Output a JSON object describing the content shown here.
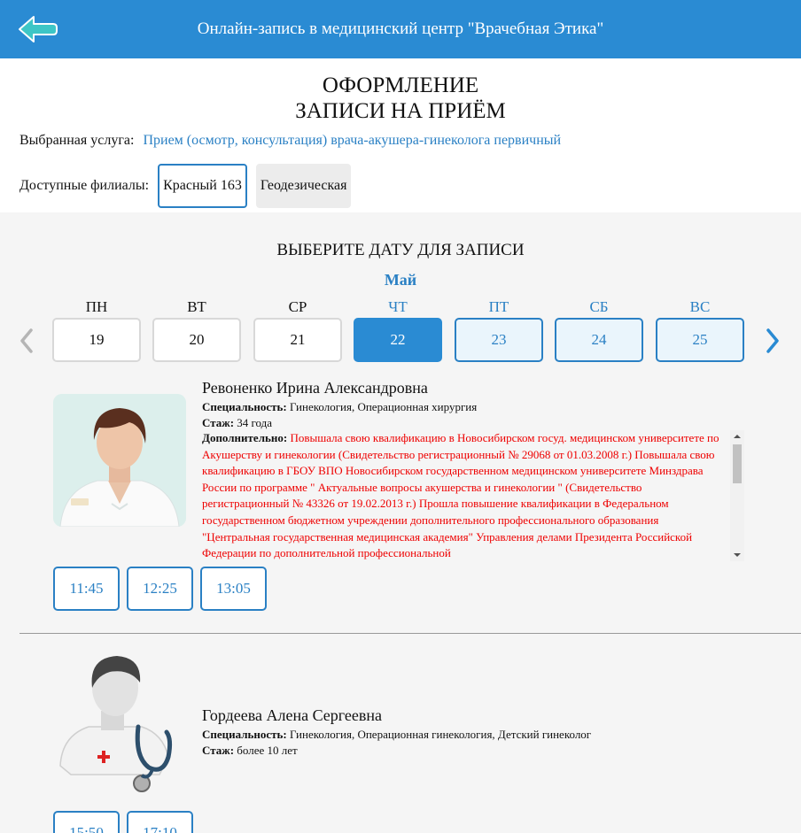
{
  "header": {
    "title": "Онлайн-запись в медицинский центр \"Врачебная Этика\"",
    "back_icon": "back-arrow-icon"
  },
  "page": {
    "title_line1": "ОФОРМЛЕНИЕ",
    "title_line2": "ЗАПИСИ НА ПРИЁМ"
  },
  "service": {
    "label": "Выбранная услуга:",
    "value": "Прием (осмотр, консультация) врача-акушера-гинеколога первичный"
  },
  "branches": {
    "label": "Доступные филиалы:",
    "items": [
      "Красный 163",
      "Геодезическая"
    ],
    "selected": "Красный 163"
  },
  "calendar": {
    "title": "ВЫБЕРИТЕ ДАТУ ДЛЯ ЗАПИСИ",
    "month": "Май",
    "days": [
      {
        "name": "ПН",
        "date": "19",
        "state": "past"
      },
      {
        "name": "ВТ",
        "date": "20",
        "state": "past"
      },
      {
        "name": "СР",
        "date": "21",
        "state": "past"
      },
      {
        "name": "ЧТ",
        "date": "22",
        "state": "selected"
      },
      {
        "name": "ПТ",
        "date": "23",
        "state": "available"
      },
      {
        "name": "СБ",
        "date": "24",
        "state": "available"
      },
      {
        "name": "ВС",
        "date": "25",
        "state": "available"
      }
    ],
    "prev_icon": "chevron-left-icon",
    "next_icon": "chevron-right-icon"
  },
  "doctors": [
    {
      "name": "Ревоненко Ирина Александровна",
      "specialty_label": "Специальность:",
      "specialty": "Гинекология, Операционная хирургия",
      "experience_label": "Стаж:",
      "experience": "34 года",
      "extra_label": "Дополнительно:",
      "extra": "Повышала свою квалификацию в Новосибирском госуд. медицинском университете по Акушерству и гинекологии (Свидетельство регистрационный № 29068 от 01.03.2008 г.) Повышала свою квалификацию в ГБОУ ВПО Новосибирском государственном медицинском университете Минздрава России по программе \" Актуальные вопросы акушерства и гинекологии \" (Свидетельство регистрационный № 43326 от 19.02.2013 г.) Прошла повышение квалификации в Федеральном государственном бюджетном учреждении дополнительного профессионального образования \"Центральная государственная медицинская академия\" Управления делами Президента Российской Федерации по дополнительной профессиональной",
      "slots": [
        "11:45",
        "12:25",
        "13:05"
      ]
    },
    {
      "name": "Гордеева Алена Сергеевна",
      "specialty_label": "Специальность:",
      "specialty": "Гинекология, Операционная гинекология, Детский гинеколог",
      "experience_label": "Стаж:",
      "experience": "более 10 лет",
      "slots": [
        "15:50",
        "17:10"
      ]
    }
  ],
  "colors": {
    "primary": "#2a8bd3",
    "link": "#2a80c4",
    "extra_text": "#e00000",
    "back_icon": "#3dc6c6"
  }
}
